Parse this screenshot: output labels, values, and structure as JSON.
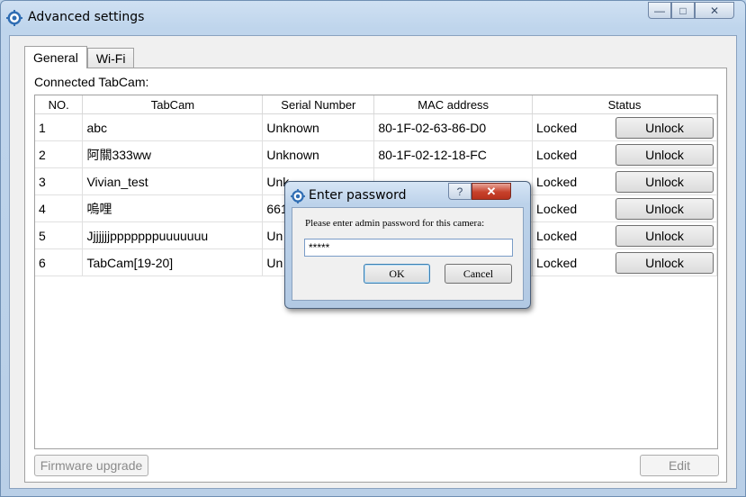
{
  "window": {
    "title": "Advanced settings",
    "controls": {
      "minimize": "—",
      "maximize": "□",
      "close": "✕"
    }
  },
  "tabs": [
    {
      "label": "General",
      "active": true
    },
    {
      "label": "Wi-Fi",
      "active": false
    }
  ],
  "section_label": "Connected TabCam:",
  "table": {
    "columns": [
      "NO.",
      "TabCam",
      "Serial Number",
      "MAC address",
      "Status"
    ],
    "rows": [
      {
        "no": "1",
        "name": "abc",
        "serial": "Unknown",
        "mac": "80-1F-02-63-86-D0",
        "status": "Locked",
        "action": "Unlock"
      },
      {
        "no": "2",
        "name": "阿關333ww",
        "serial": "Unknown",
        "mac": "80-1F-02-12-18-FC",
        "status": "Locked",
        "action": "Unlock"
      },
      {
        "no": "3",
        "name": "Vivian_test",
        "serial": "Unk",
        "mac": "",
        "status": "Locked",
        "action": "Unlock"
      },
      {
        "no": "4",
        "name": "嗚哩",
        "serial": "661",
        "mac": "",
        "status": "Locked",
        "action": "Unlock"
      },
      {
        "no": "5",
        "name": "Jjjjjjjpppppppuuuuuuu",
        "serial": "Un",
        "mac": "",
        "status": "Locked",
        "action": "Unlock"
      },
      {
        "no": "6",
        "name": "TabCam[19-20]",
        "serial": "Un",
        "mac": "",
        "status": "Locked",
        "action": "Unlock"
      }
    ]
  },
  "footer": {
    "firmware_label": "Firmware upgrade",
    "edit_label": "Edit"
  },
  "dialog": {
    "title": "Enter password",
    "help": "?",
    "close": "✕",
    "message": "Please enter admin password for this camera:",
    "password_value": "*****",
    "ok_label": "OK",
    "cancel_label": "Cancel"
  }
}
